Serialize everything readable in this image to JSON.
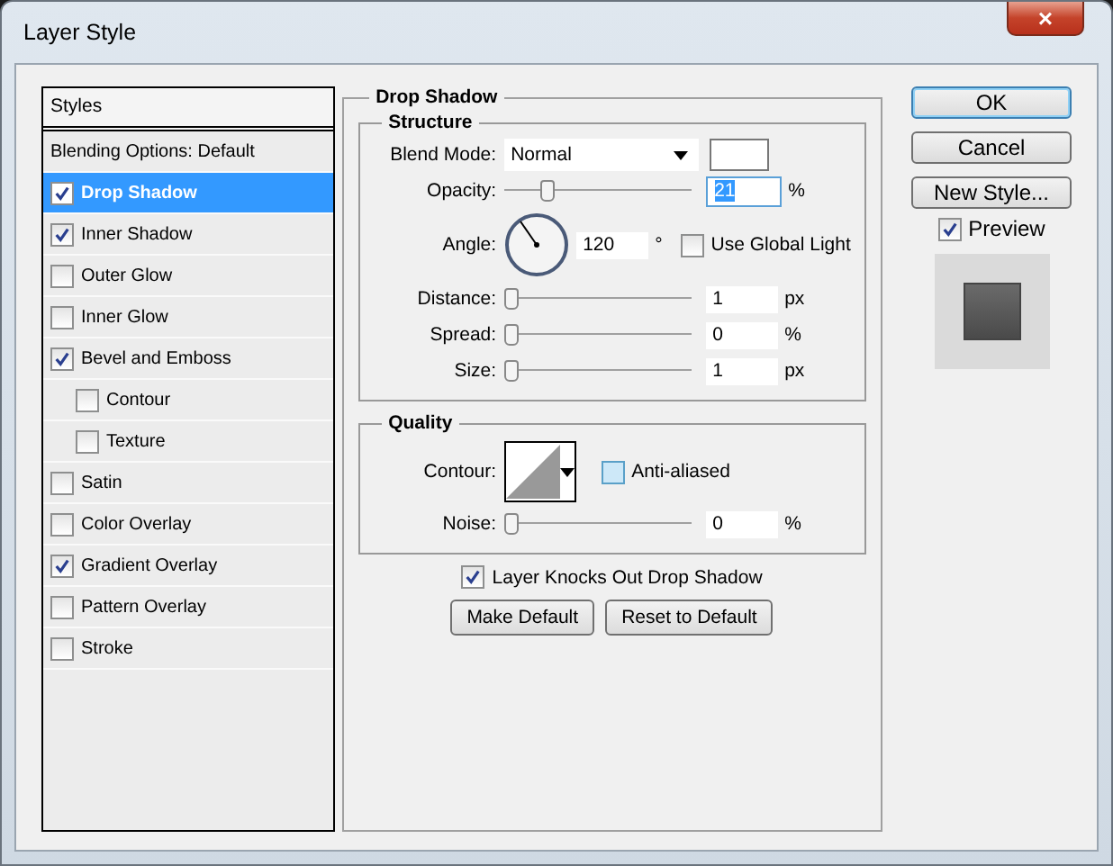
{
  "window": {
    "title": "Layer Style",
    "close": "×"
  },
  "styles": {
    "header": "Styles",
    "items": [
      {
        "kind": "plain",
        "label": "Blending Options: Default",
        "selected": false
      },
      {
        "kind": "check",
        "label": "Drop Shadow",
        "checked": true,
        "selected": true
      },
      {
        "kind": "check",
        "label": "Inner Shadow",
        "checked": true,
        "selected": false
      },
      {
        "kind": "check",
        "label": "Outer Glow",
        "checked": false,
        "selected": false
      },
      {
        "kind": "check",
        "label": "Inner Glow",
        "checked": false,
        "selected": false
      },
      {
        "kind": "check",
        "label": "Bevel and Emboss",
        "checked": true,
        "selected": false,
        "children": [
          {
            "kind": "check",
            "label": "Contour",
            "checked": false,
            "selected": false
          },
          {
            "kind": "check",
            "label": "Texture",
            "checked": false,
            "selected": false
          }
        ]
      },
      {
        "kind": "check",
        "label": "Satin",
        "checked": false,
        "selected": false
      },
      {
        "kind": "check",
        "label": "Color Overlay",
        "checked": false,
        "selected": false
      },
      {
        "kind": "check",
        "label": "Gradient Overlay",
        "checked": true,
        "selected": false
      },
      {
        "kind": "check",
        "label": "Pattern Overlay",
        "checked": false,
        "selected": false
      },
      {
        "kind": "check",
        "label": "Stroke",
        "checked": false,
        "selected": false
      }
    ]
  },
  "panel": {
    "title": "Drop Shadow",
    "structure": {
      "title": "Structure",
      "rows": [
        {
          "kind": "select",
          "label": "Blend Mode:",
          "value": "Normal"
        },
        {
          "kind": "slider",
          "label": "Opacity:",
          "level": 0.21,
          "value": "21",
          "unit": "%",
          "focused": true
        },
        {
          "kind": "angle",
          "label": "Angle:",
          "value": "120",
          "unit": "°",
          "option": "Use Global Light",
          "checked": false
        },
        {
          "kind": "slider",
          "label": "Distance:",
          "level": 0,
          "value": "1",
          "unit": "px",
          "focused": false
        },
        {
          "kind": "slider",
          "label": "Spread:",
          "level": 0,
          "value": "0",
          "unit": "%",
          "focused": false
        },
        {
          "kind": "slider",
          "label": "Size:",
          "level": 0,
          "value": "1",
          "unit": "px",
          "focused": false
        }
      ]
    },
    "quality": {
      "title": "Quality",
      "rows": [
        {
          "kind": "contour",
          "label": "Contour:",
          "option": "Anti-aliased",
          "checked": false
        },
        {
          "kind": "slider",
          "label": "Noise:",
          "level": 0,
          "value": "0",
          "unit": "%",
          "focused": false
        }
      ]
    },
    "knockout": {
      "label": "Layer Knocks Out Drop Shadow",
      "checked": true
    },
    "buttons": [
      "Make Default",
      "Reset to Default"
    ]
  },
  "buttons": [
    "OK",
    "Cancel",
    "New Style..."
  ],
  "preview": {
    "label": "Preview",
    "checked": true
  }
}
